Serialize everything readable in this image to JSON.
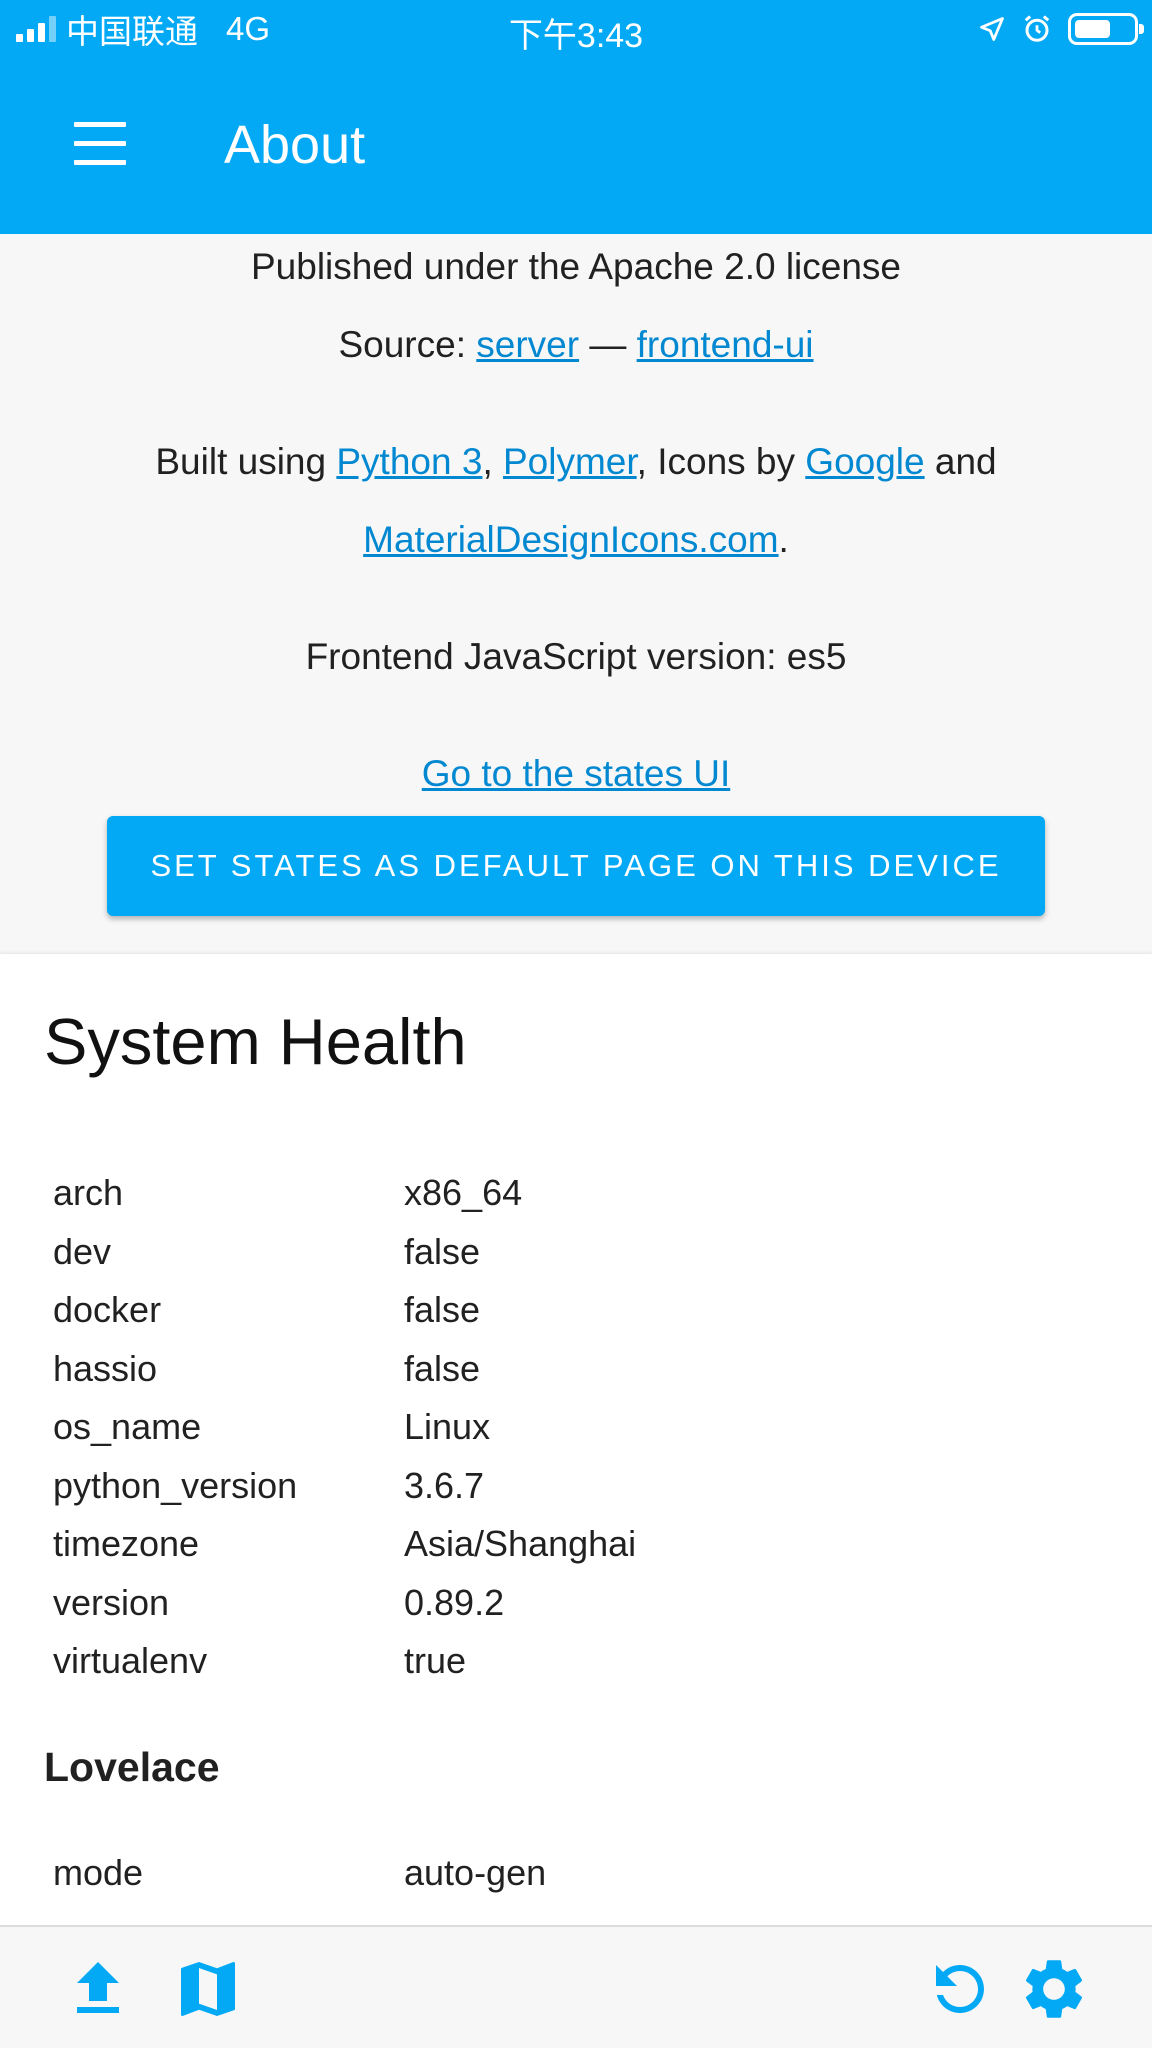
{
  "status_bar": {
    "carrier": "中国联通",
    "network": "4G",
    "time": "下午3:43"
  },
  "toolbar": {
    "title": "About",
    "menu_icon": "menu-icon"
  },
  "about": {
    "license_text": "Published under the Apache 2.0 license",
    "source_prefix": "Source: ",
    "source_server": "server",
    "source_sep": " — ",
    "source_frontend": "frontend-ui",
    "built_prefix": "Built using ",
    "built_python": "Python 3",
    "built_comma": ", ",
    "built_polymer": "Polymer",
    "built_icons_by": ", Icons by ",
    "built_google": "Google",
    "built_and": " and",
    "built_mdi": "MaterialDesignIcons.com",
    "built_period": ".",
    "frontend_version": "Frontend JavaScript version: es5",
    "states_link": "Go to the states UI",
    "set_default_button": "SET STATES AS DEFAULT PAGE ON THIS DEVICE"
  },
  "system_health": {
    "title": "System Health",
    "rows": [
      {
        "key": "arch",
        "value": "x86_64"
      },
      {
        "key": "dev",
        "value": "false"
      },
      {
        "key": "docker",
        "value": "false"
      },
      {
        "key": "hassio",
        "value": "false"
      },
      {
        "key": "os_name",
        "value": "Linux"
      },
      {
        "key": "python_version",
        "value": "3.6.7"
      },
      {
        "key": "timezone",
        "value": "Asia/Shanghai"
      },
      {
        "key": "version",
        "value": "0.89.2"
      },
      {
        "key": "virtualenv",
        "value": "true"
      }
    ],
    "lovelace": {
      "title": "Lovelace",
      "key": "mode",
      "value": "auto-gen"
    }
  },
  "bottom_bar": {
    "icons": [
      "upload-icon",
      "map-icon",
      "refresh-icon",
      "settings-icon"
    ]
  },
  "colors": {
    "primary": "#03a9f4",
    "link": "#0288d1",
    "background": "#f7f7f7",
    "card": "#ffffff"
  }
}
